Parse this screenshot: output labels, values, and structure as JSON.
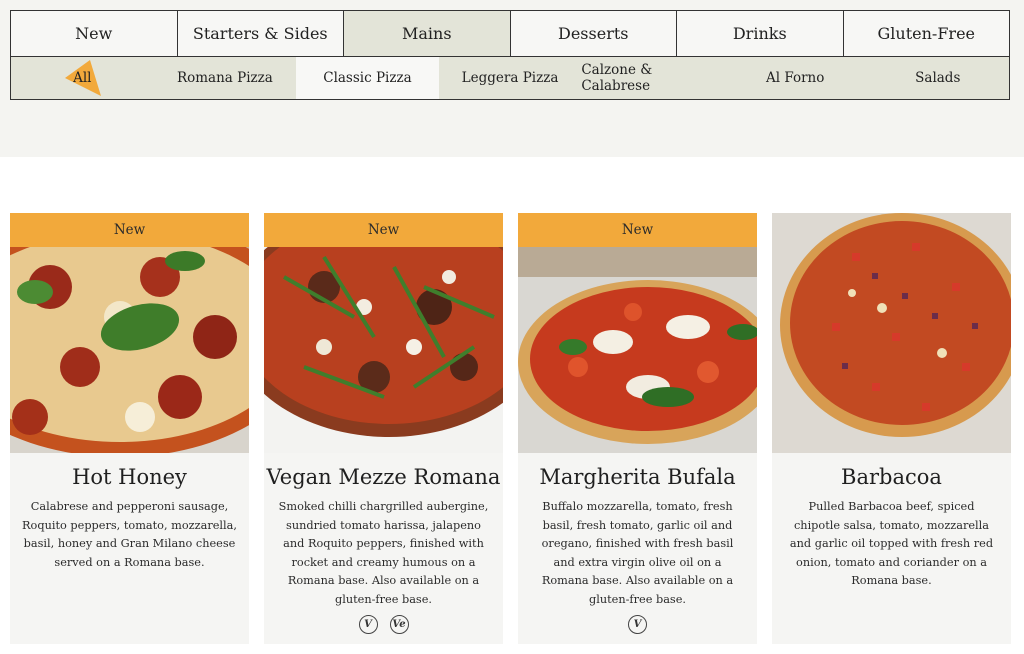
{
  "main_tabs": [
    {
      "label": "New"
    },
    {
      "label": "Starters & Sides"
    },
    {
      "label": "Mains",
      "active": true
    },
    {
      "label": "Desserts"
    },
    {
      "label": "Drinks"
    },
    {
      "label": "Gluten-Free"
    }
  ],
  "sub_tabs": [
    {
      "label": "All",
      "marker": "triangle-marker"
    },
    {
      "label": "Romana Pizza"
    },
    {
      "label": "Classic Pizza",
      "active": true
    },
    {
      "label": "Leggera Pizza"
    },
    {
      "label": "Calzone & Calabrese"
    },
    {
      "label": "Al Forno"
    },
    {
      "label": "Salads"
    }
  ],
  "colors": {
    "badge": "#f2a93b",
    "active_tab": "#e3e4d8",
    "card_bg": "#f5f5f3"
  },
  "products": [
    {
      "badge": "New",
      "name": "Hot Honey",
      "description": "Calabrese and pepperoni sausage, Roquito peppers, tomato, mozzarella, basil, honey and Gran Milano cheese served on a Romana base.",
      "diet_icons": []
    },
    {
      "badge": "New",
      "name": "Vegan Mezze Romana",
      "description": "Smoked chilli chargrilled aubergine, sundried tomato harissa, jalapeno and Roquito peppers, finished with rocket and creamy humous on a Romana base. Also available on a gluten-free base.",
      "diet_icons": [
        {
          "label": "V",
          "icon": "vegetarian-icon"
        },
        {
          "label": "Ve",
          "icon": "vegan-icon"
        }
      ]
    },
    {
      "badge": "New",
      "name": "Margherita Bufala",
      "description": "Buffalo mozzarella, tomato, fresh basil, fresh tomato, garlic oil and oregano, finished with fresh basil and extra virgin olive oil on a Romana base. Also available on a gluten-free base.",
      "diet_icons": [
        {
          "label": "V",
          "icon": "vegetarian-icon"
        }
      ]
    },
    {
      "badge": "",
      "name": "Barbacoa",
      "description": "Pulled Barbacoa beef, spiced chipotle salsa, tomato, mozzarella and garlic oil topped with fresh red onion, tomato and coriander on a Romana base.",
      "diet_icons": []
    }
  ]
}
